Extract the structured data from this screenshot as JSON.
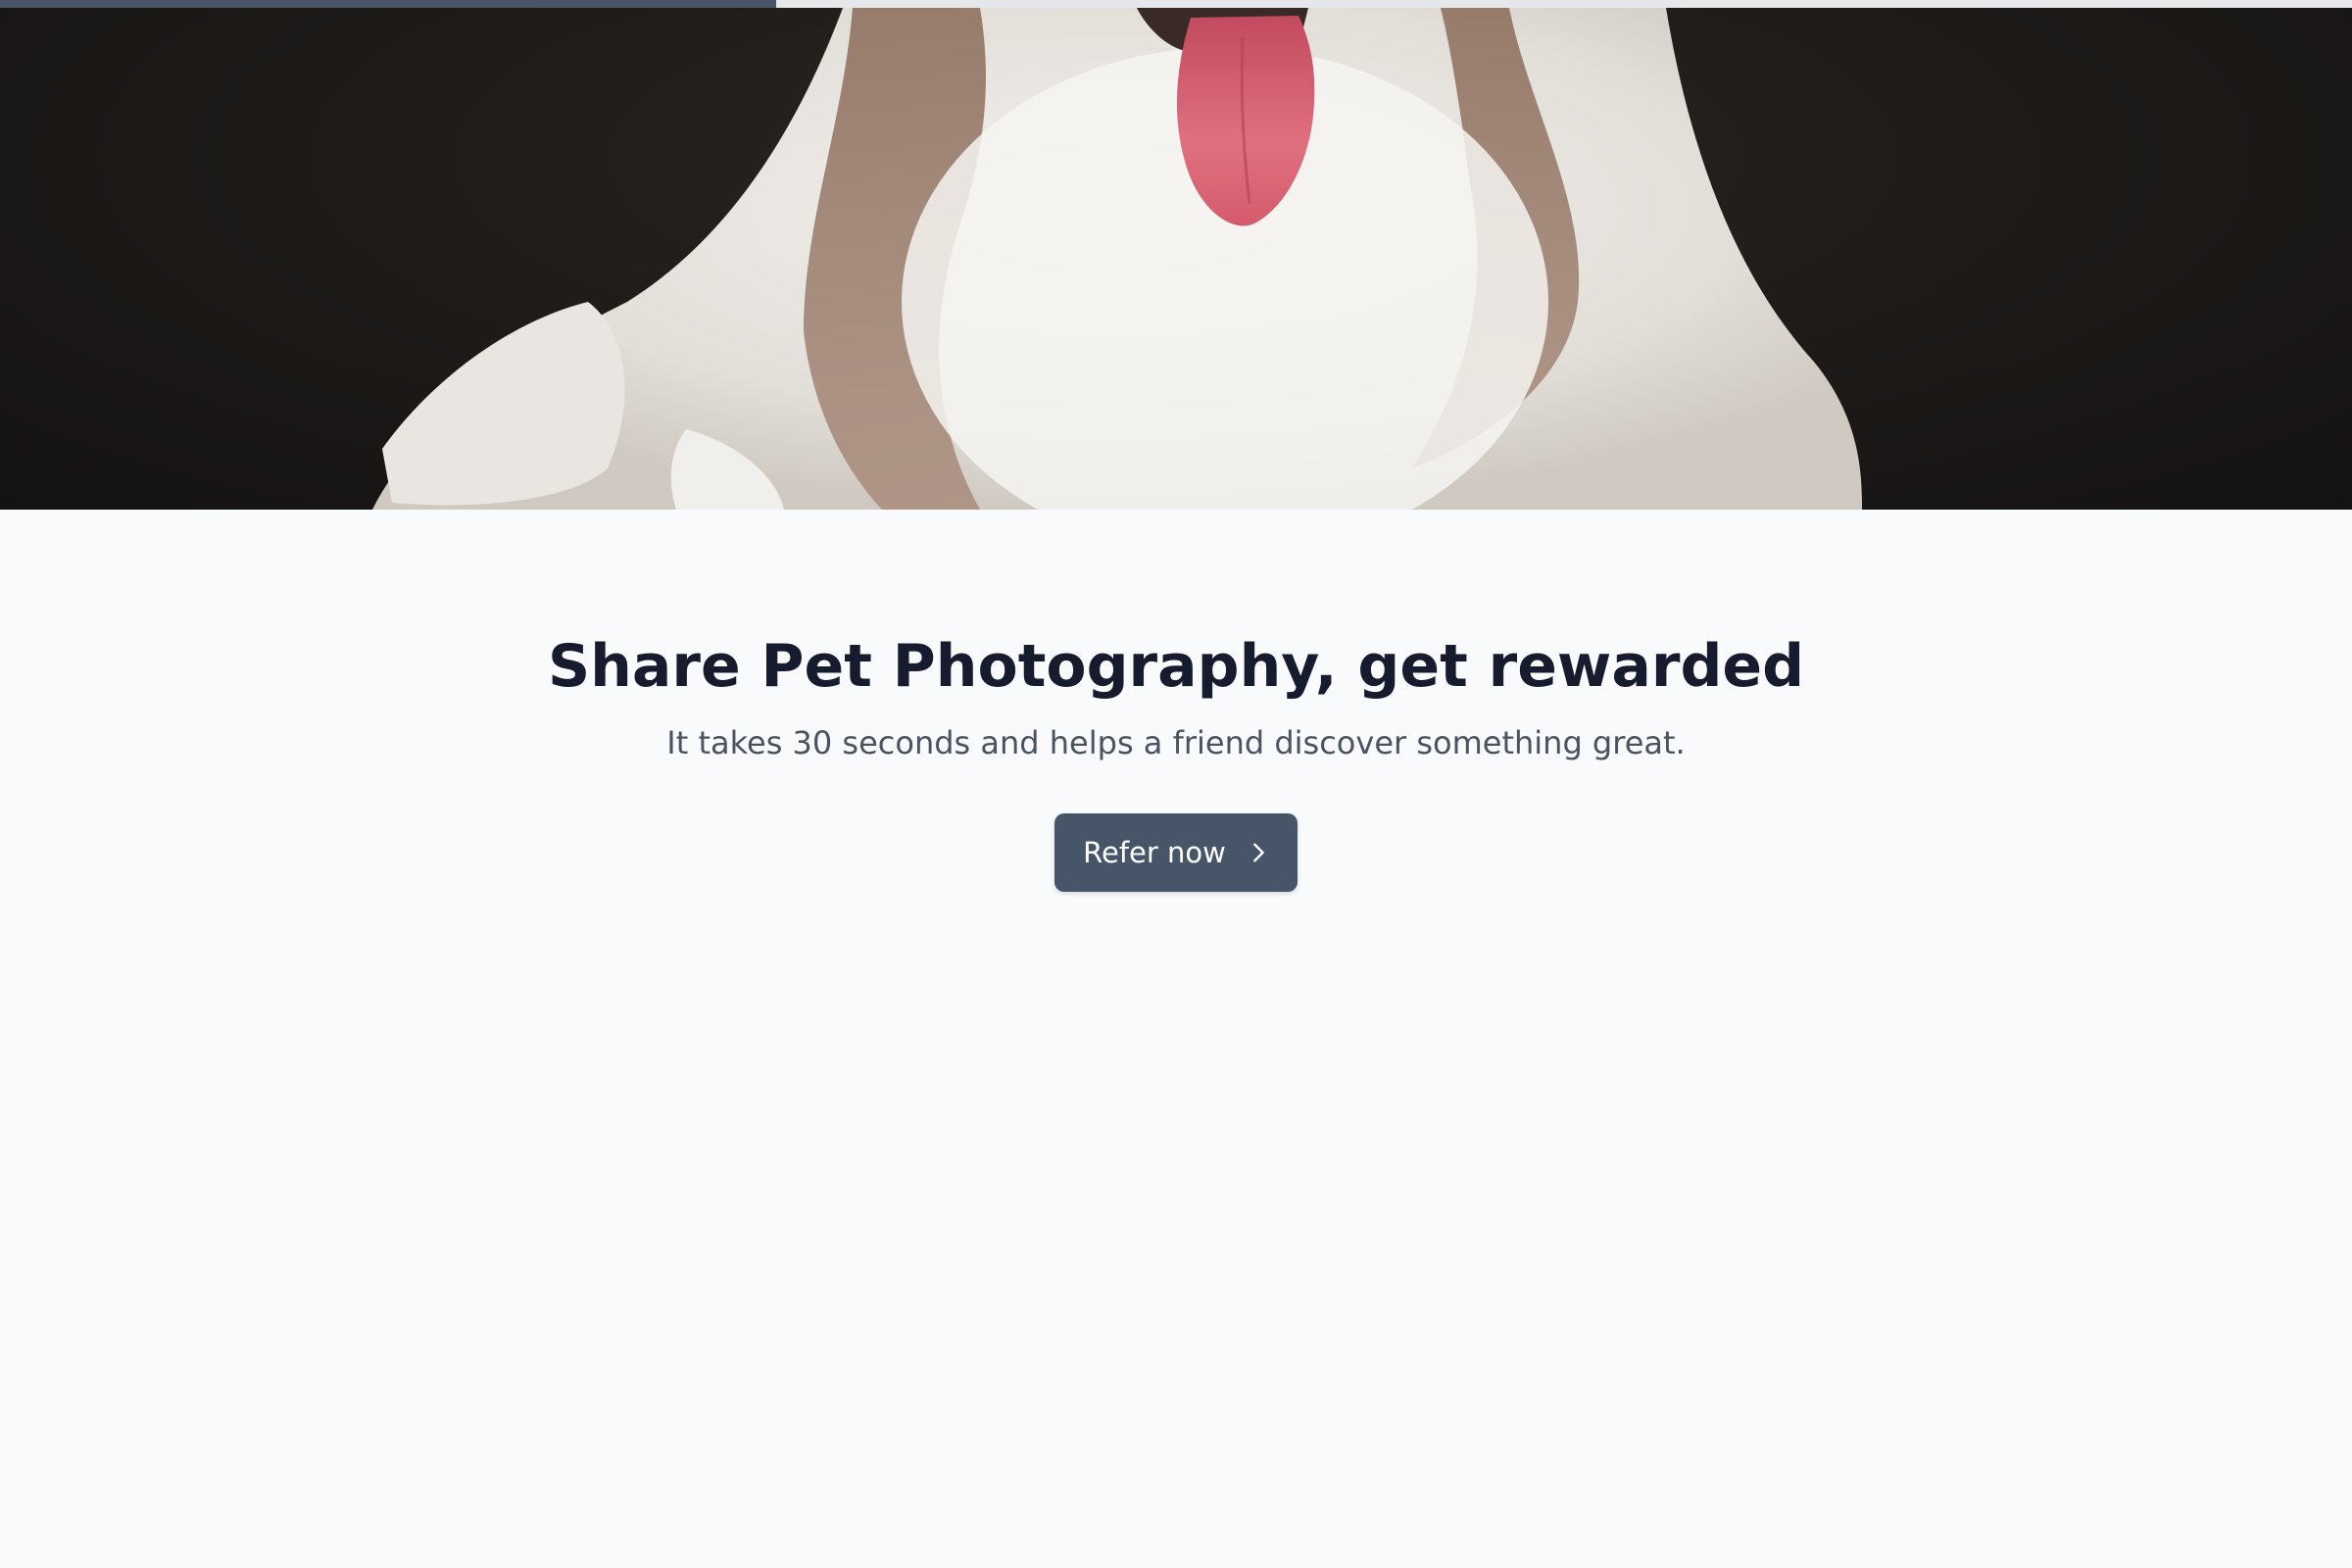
{
  "progress": {
    "fraction": 0.33
  },
  "hero": {
    "image_subject": "dog-photo"
  },
  "headline": "Share Pet Photography, get rewarded",
  "subtext": "It takes 30 seconds and helps a friend discover something great.",
  "cta": {
    "label": "Refer now",
    "icon": "chevron-right-icon"
  },
  "colors": {
    "page_background": "#f8fafc",
    "headline": "#161b2e",
    "subtext": "#4b5261",
    "button": "#475569",
    "progress_fill": "#4a5568",
    "progress_track": "#e5e7eb"
  }
}
